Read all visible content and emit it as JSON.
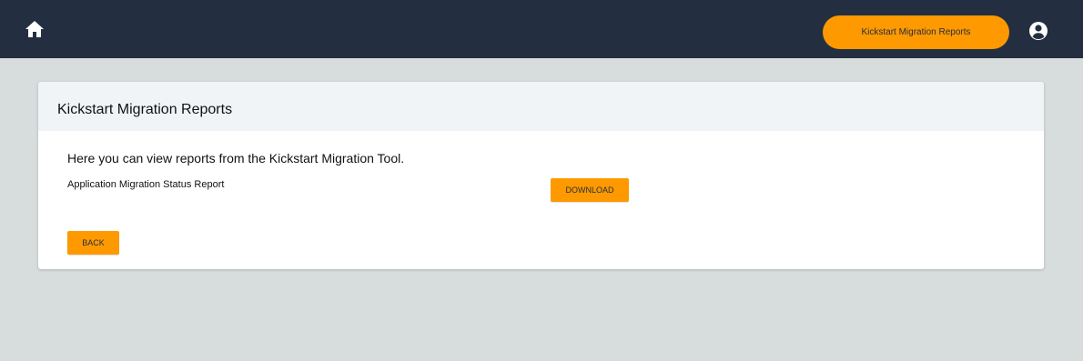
{
  "header": {
    "home_icon": "home-icon",
    "nav_button_label": "Kickstart Migration Reports",
    "account_icon": "account-circle-icon",
    "background_color": "#232f40",
    "accent_color": "#ff9900"
  },
  "card": {
    "title": "Kickstart Migration Reports",
    "intro": "Here you can view reports from the Kickstart Migration Tool.",
    "reports": [
      {
        "name": "Application Migration Status Report",
        "action_label": "DOWNLOAD"
      }
    ],
    "back_label": "BACK"
  }
}
